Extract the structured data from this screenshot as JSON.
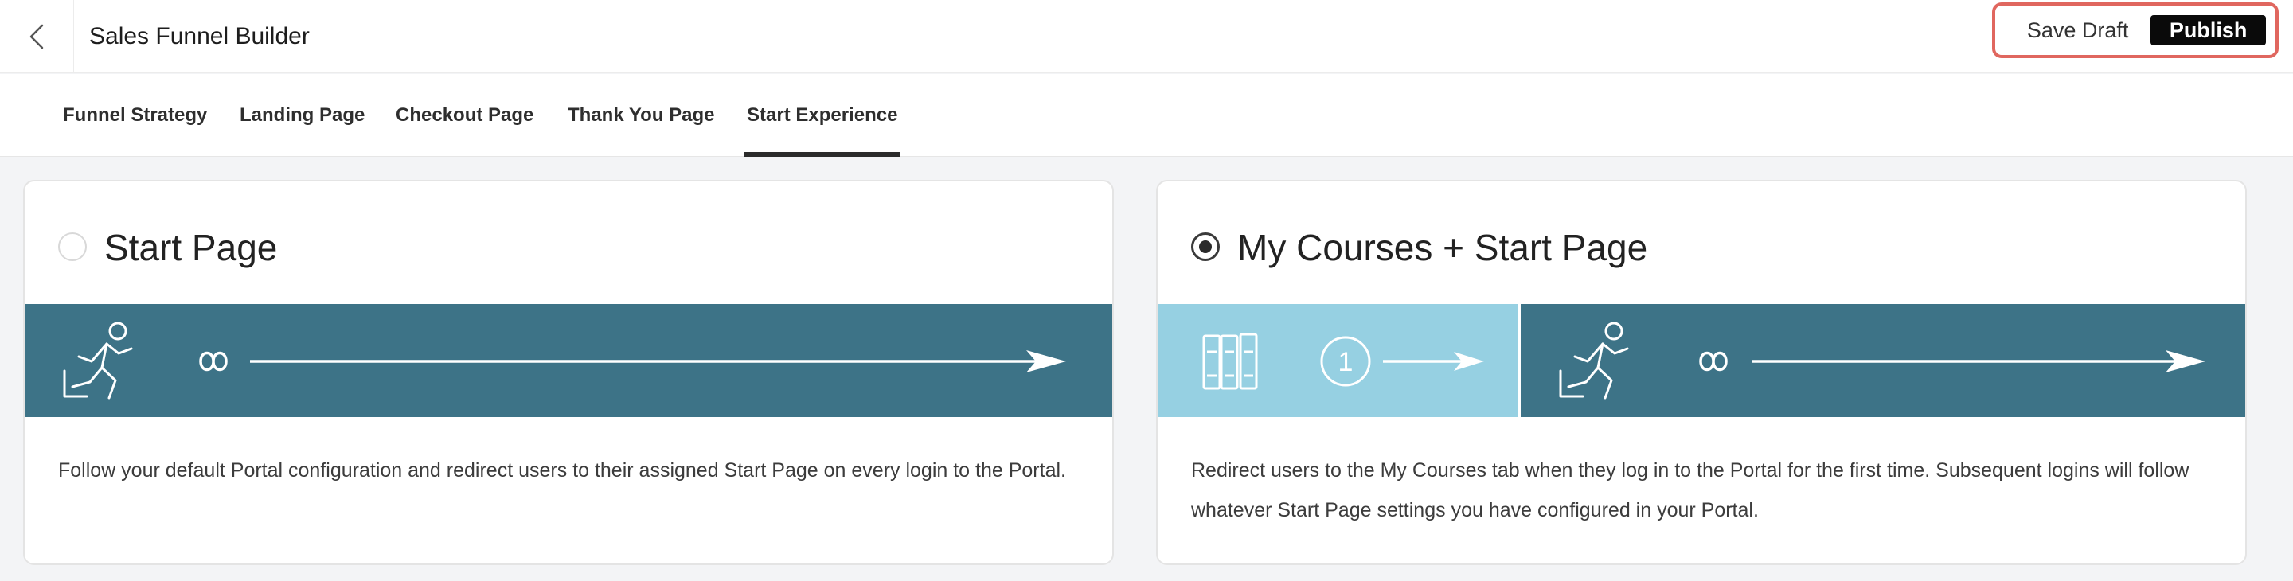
{
  "header": {
    "title": "Sales Funnel Builder",
    "save_draft_label": "Save Draft",
    "publish_label": "Publish"
  },
  "tabs": [
    {
      "label": "Funnel Strategy",
      "active": false
    },
    {
      "label": "Landing Page",
      "active": false
    },
    {
      "label": "Checkout Page",
      "active": false
    },
    {
      "label": "Thank You Page",
      "active": false
    },
    {
      "label": "Start Experience",
      "active": true
    }
  ],
  "options": [
    {
      "title": "Start Page",
      "selected": false,
      "description": "Follow your default Portal configuration and redirect users to their assigned Start Page on every login to the Portal.",
      "icons": [
        "running-person-icon",
        "infinity-icon",
        "arrow-right-icon"
      ]
    },
    {
      "title": "My Courses + Start Page",
      "selected": true,
      "description": "Redirect users to the My Courses tab when they log in to the Portal for the first time. Subsequent logins will follow whatever Start Page settings you have configured in your Portal.",
      "first_login_count": "1",
      "icons": [
        "books-icon",
        "number-one-circle-icon",
        "arrow-right-icon",
        "running-person-icon",
        "infinity-icon",
        "arrow-right-icon"
      ]
    }
  ],
  "colors": {
    "banner_dark": "#3d7387",
    "banner_light": "#96d0e2",
    "publish_bg": "#0a0a0a",
    "highlight_border": "#e0675f"
  }
}
